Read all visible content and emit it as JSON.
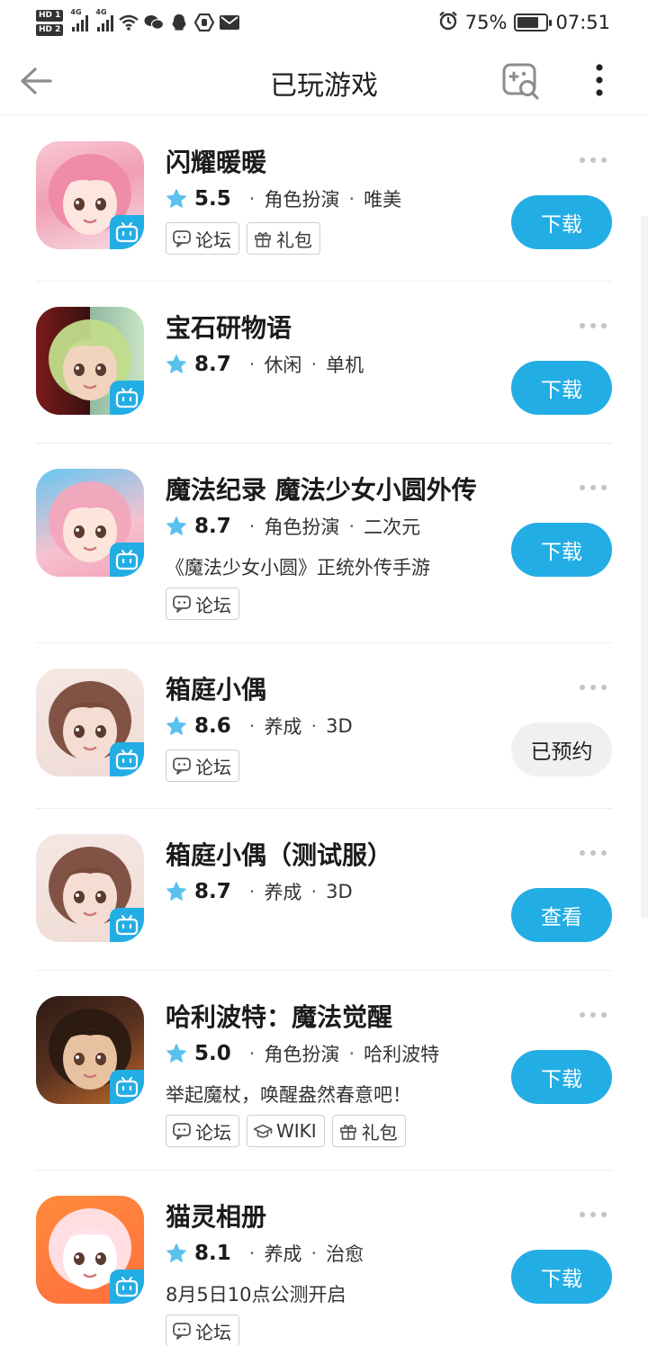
{
  "status_bar": {
    "sim1": "HD 1",
    "sim2": "HD 2",
    "net1": "4G",
    "net2": "4G",
    "battery_percent": "75%",
    "battery_level": 0.75,
    "time": "07:51"
  },
  "header": {
    "title": "已玩游戏"
  },
  "colors": {
    "accent": "#23ade5",
    "booked_bg": "#f0f0f0"
  },
  "games": [
    {
      "name": "闪耀暖暖",
      "rating": "5.5",
      "categories": [
        "角色扮演",
        "唯美"
      ],
      "description": "",
      "tags": [
        {
          "icon": "forum-icon",
          "label": "论坛"
        },
        {
          "icon": "gift-icon",
          "label": "礼包"
        }
      ],
      "action": "下载",
      "booked": false
    },
    {
      "name": "宝石研物语",
      "rating": "8.7",
      "categories": [
        "休闲",
        "单机"
      ],
      "description": "",
      "tags": [],
      "action": "下载",
      "booked": false
    },
    {
      "name": "魔法纪录  魔法少女小圆外传",
      "rating": "8.7",
      "categories": [
        "角色扮演",
        "二次元"
      ],
      "description": "《魔法少女小圆》正统外传手游",
      "tags": [
        {
          "icon": "forum-icon",
          "label": "论坛"
        }
      ],
      "action": "下载",
      "booked": false
    },
    {
      "name": "箱庭小偶",
      "rating": "8.6",
      "categories": [
        "养成",
        "3D"
      ],
      "description": "",
      "tags": [
        {
          "icon": "forum-icon",
          "label": "论坛"
        }
      ],
      "action": "已预约",
      "booked": true
    },
    {
      "name": "箱庭小偶（测试服）",
      "rating": "8.7",
      "categories": [
        "养成",
        "3D"
      ],
      "description": "",
      "tags": [],
      "action": "查看",
      "booked": false
    },
    {
      "name": "哈利波特：魔法觉醒",
      "rating": "5.0",
      "categories": [
        "角色扮演",
        "哈利波特"
      ],
      "description": "举起魔杖，唤醒盎然春意吧！",
      "tags": [
        {
          "icon": "forum-icon",
          "label": "论坛"
        },
        {
          "icon": "wiki-icon",
          "label": "WIKI"
        },
        {
          "icon": "gift-icon",
          "label": "礼包"
        }
      ],
      "action": "下载",
      "booked": false
    },
    {
      "name": "猫灵相册",
      "rating": "8.1",
      "categories": [
        "养成",
        "治愈"
      ],
      "description": "8月5日10点公测开启",
      "tags": [
        {
          "icon": "forum-icon",
          "label": "论坛"
        }
      ],
      "action": "下载",
      "booked": false
    }
  ]
}
